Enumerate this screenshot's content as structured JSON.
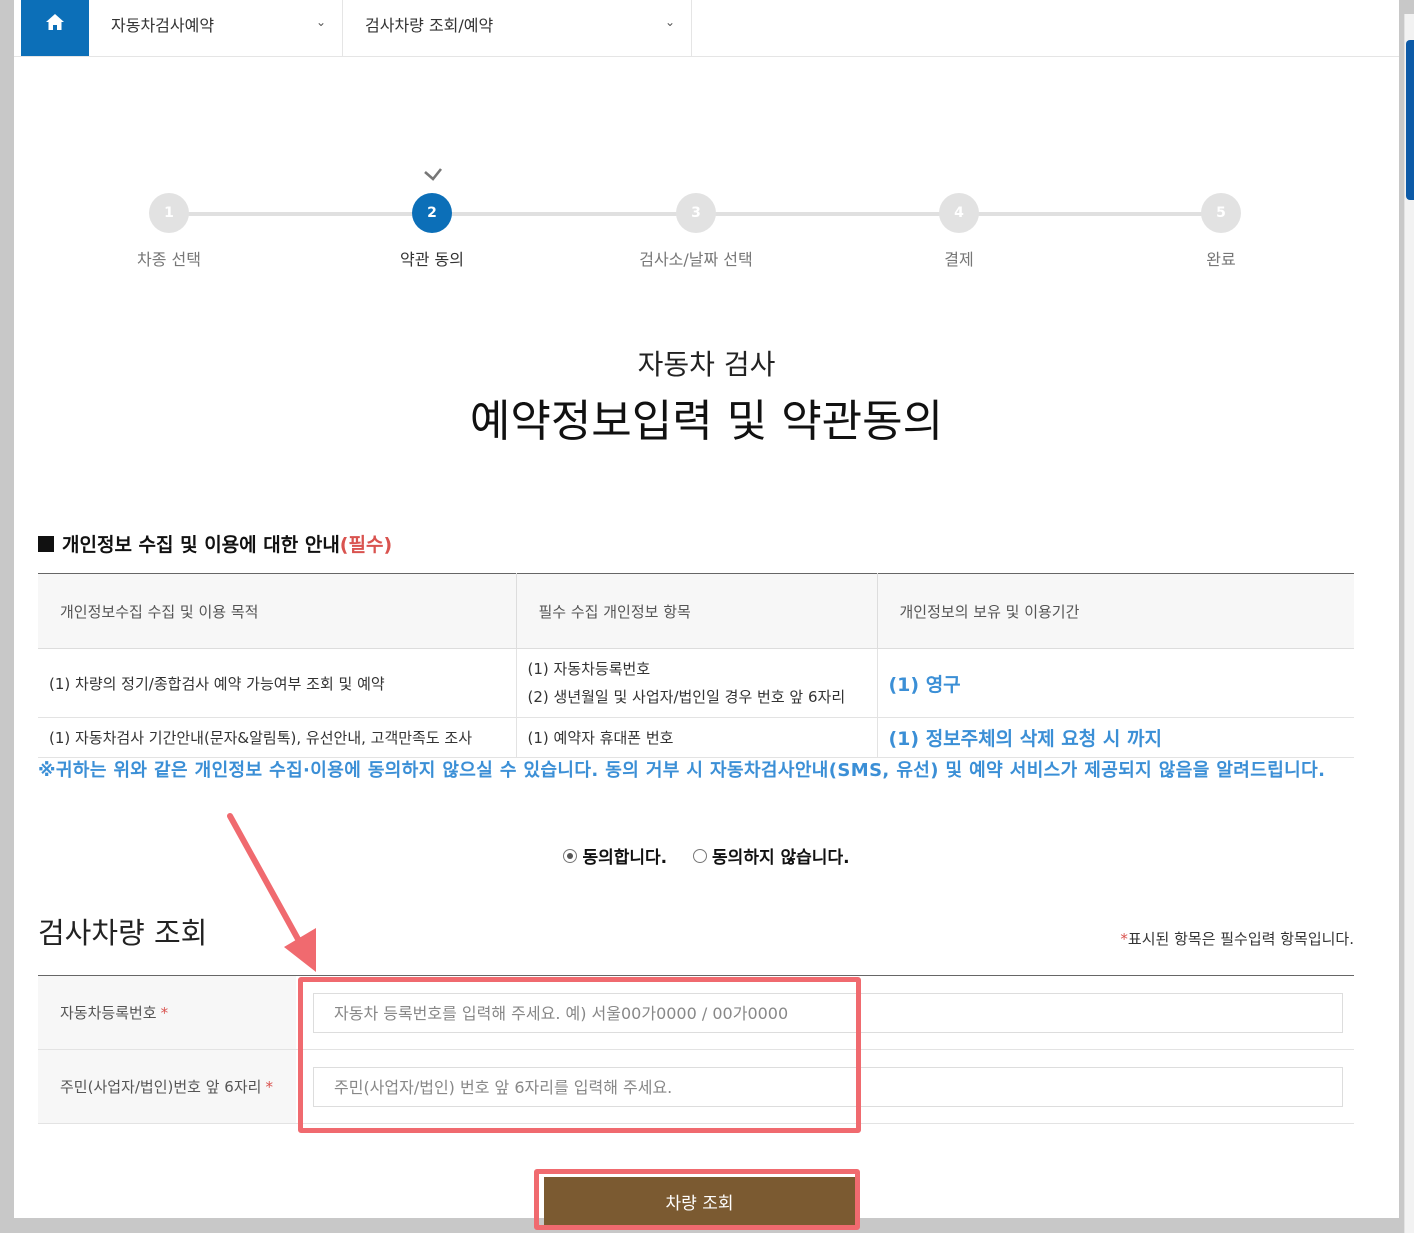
{
  "nav": {
    "home_icon": "home-icon",
    "menu1": "자동차검사예약",
    "menu2": "검사차량 조회/예약"
  },
  "steps": [
    {
      "num": "1",
      "label": "차종 선택"
    },
    {
      "num": "2",
      "label": "약관 동의"
    },
    {
      "num": "3",
      "label": "검사소/날짜 선택"
    },
    {
      "num": "4",
      "label": "결제"
    },
    {
      "num": "5",
      "label": "완료"
    }
  ],
  "title": {
    "sub": "자동차 검사",
    "main": "예약정보입력 및 약관동의"
  },
  "privacy": {
    "heading": "개인정보 수집 및 이용에 대한 안내",
    "heading_req": "(필수)",
    "columns": [
      "개인정보수집 수집 및 이용 목적",
      "필수 수집 개인정보 항목",
      "개인정보의 보유 및 이용기간"
    ],
    "rows": [
      {
        "purpose": "(1) 차량의 정기/종합검사 예약 가능여부 조회 및 예약",
        "items": [
          "(1) 자동차등록번호",
          "(2) 생년월일 및 사업자/법인일 경우 번호 앞 6자리"
        ],
        "period": "(1) 영구"
      },
      {
        "purpose": "(1) 자동차검사 기간안내(문자&알림톡), 유선안내, 고객만족도 조사",
        "items": [
          "(1) 예약자 휴대폰 번호"
        ],
        "period": "(1) 정보주체의 삭제 요청 시 까지"
      }
    ],
    "notice": "※귀하는 위와 같은 개인정보 수집·이용에 동의하지 않으실 수 있습니다. 동의 거부 시 자동차검사안내(SMS, 유선) 및 예약 서비스가 제공되지 않음을 알려드립니다.",
    "agree_label": "동의합니다.",
    "disagree_label": "동의하지 않습니다."
  },
  "lookup": {
    "title": "검사차량 조회",
    "req_star": "*",
    "req_note": "표시된 항목은 필수입력 항목입니다.",
    "reg_label": "자동차등록번호",
    "reg_placeholder": "자동차 등록번호를 입력해 주세요. 예) 서울00가0000 / 00가0000",
    "id_label": "주민(사업자/법인)번호 앞 6자리",
    "id_placeholder": "주민(사업자/법인) 번호 앞 6자리를 입력해 주세요.",
    "star": "*",
    "button": "차량 조회"
  },
  "colors": {
    "primary": "#0c6fb8",
    "required": "#d9534f",
    "notice": "#3b8fd6",
    "button": "#7b5a31",
    "annotation": "#f06a6f"
  }
}
